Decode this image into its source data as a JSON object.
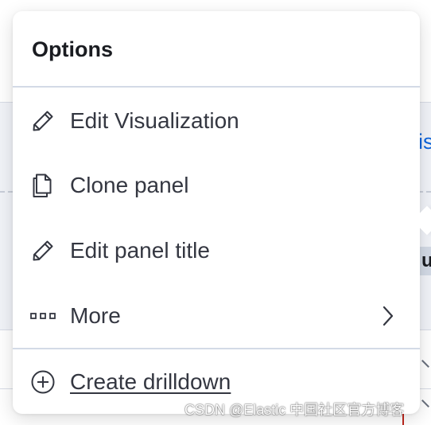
{
  "background": {
    "link_fragment": "is",
    "chip_fragment": "u"
  },
  "popover": {
    "title": "Options",
    "items": [
      {
        "label": "Edit Visualization",
        "icon": "pencil-icon"
      },
      {
        "label": "Clone panel",
        "icon": "copy-icon"
      },
      {
        "label": "Edit panel title",
        "icon": "pencil-icon"
      },
      {
        "label": "More",
        "icon": "more-dots-icon",
        "trailing_icon": "chevron-right-icon"
      }
    ],
    "footer_item": {
      "label": "Create drilldown",
      "icon": "plus-in-circle-icon"
    }
  },
  "watermark": "CSDN @Elastic 中国社区官方博客",
  "colors": {
    "text": "#343741",
    "title": "#1a1c21",
    "divider": "#d3dae6",
    "link": "#0b64dd"
  }
}
